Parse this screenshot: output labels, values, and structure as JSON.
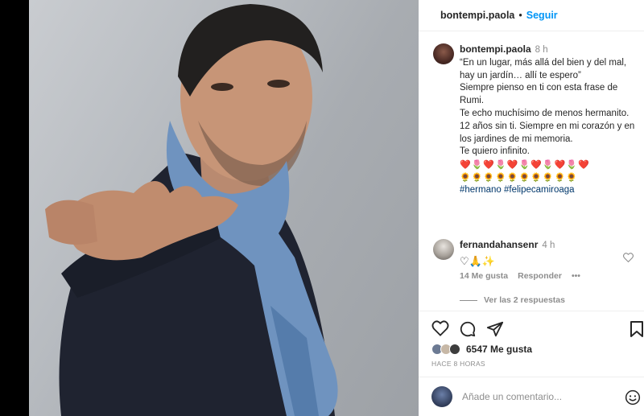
{
  "post": {
    "author": "bontempi.paola",
    "follow_label": "Seguir",
    "separator": "•"
  },
  "caption": {
    "author": "bontempi.paola",
    "time": "8 h",
    "lines": [
      "“En un lugar, más allá del bien y del mal, hay un jardín… allí te espero”",
      "Siempre pienso en ti con esta frase de Rumi.",
      "Te echo muchísimo de menos hermanito.",
      "12 años sin ti. Siempre en mi corazón y en los jardines de mi memoria.",
      "Te quiero infinito."
    ],
    "emoji_row1": "❤️🌷❤️🌷❤️🌷❤️🌷❤️🌷❤️",
    "emoji_row2": "🌻🌻🌻🌻🌻🌻🌻🌻🌻🌻",
    "hashtags": "#hermano #felipecamiroaga"
  },
  "comment": {
    "author": "fernandahansenr",
    "time": "4 h",
    "body": "♡🙏✨",
    "likes": "14 Me gusta",
    "reply_label": "Responder",
    "more_label": "•••",
    "view_replies": "Ver las 2 respuestas"
  },
  "likes": {
    "count": "6547 Me gusta",
    "posted": "HACE 8 HORAS"
  },
  "add_comment": {
    "placeholder": "Añade un comentario..."
  },
  "icons": {
    "like": "heart-icon",
    "comment": "comment-icon",
    "share": "share-icon",
    "save": "bookmark-icon",
    "emoji": "smiley-icon"
  },
  "colors": {
    "follow_blue": "#0095f6",
    "hashtag": "#00376b",
    "muted": "#8e8e8e"
  }
}
